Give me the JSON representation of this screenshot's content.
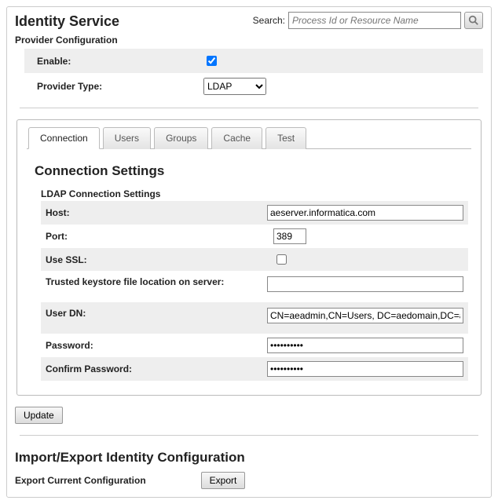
{
  "header": {
    "title": "Identity Service",
    "search_label": "Search:",
    "search_placeholder": "Process Id or Resource Name"
  },
  "provider": {
    "subtitle": "Provider Configuration",
    "enable_label": "Enable:",
    "enable_checked": true,
    "type_label": "Provider Type:",
    "type_value": "LDAP"
  },
  "tabs": [
    {
      "id": "connection",
      "label": "Connection",
      "active": true
    },
    {
      "id": "users",
      "label": "Users",
      "active": false
    },
    {
      "id": "groups",
      "label": "Groups",
      "active": false
    },
    {
      "id": "cache",
      "label": "Cache",
      "active": false
    },
    {
      "id": "test",
      "label": "Test",
      "active": false
    }
  ],
  "connection": {
    "section_title": "Connection Settings",
    "sub_title": "LDAP Connection Settings",
    "fields": {
      "host_label": "Host:",
      "host_value": "aeserver.informatica.com",
      "port_label": "Port:",
      "port_value": "389",
      "use_ssl_label": "Use SSL:",
      "use_ssl_checked": false,
      "keystore_label": "Trusted keystore file location on server:",
      "keystore_value": "",
      "userdn_label": "User DN:",
      "userdn_value": "CN=aeadmin,CN=Users, DC=aedomain,DC=a",
      "password_label": "Password:",
      "password_value": "••••••••••",
      "confirm_label": "Confirm Password:",
      "confirm_value": "••••••••••"
    }
  },
  "buttons": {
    "update": "Update",
    "export": "Export"
  },
  "import_export": {
    "title": "Import/Export Identity Configuration",
    "export_label": "Export Current Configuration"
  }
}
